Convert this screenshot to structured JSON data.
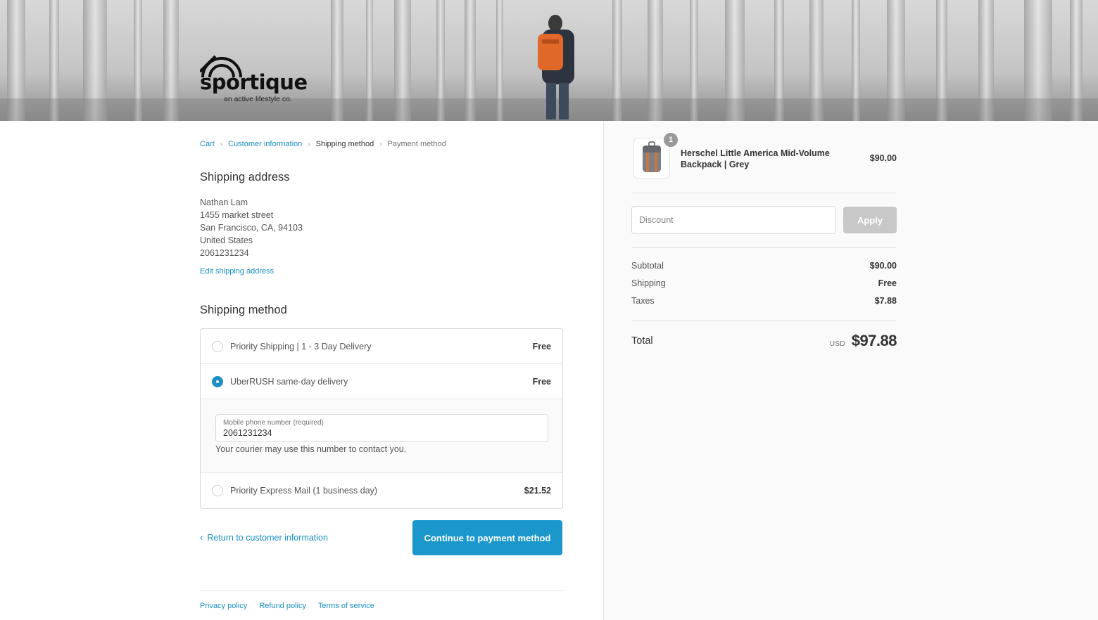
{
  "brand": {
    "name": "sportique",
    "tagline": "an active lifestyle co."
  },
  "breadcrumb": {
    "items": [
      {
        "label": "Cart"
      },
      {
        "label": "Customer information"
      },
      {
        "label": "Shipping method"
      },
      {
        "label": "Payment method"
      }
    ]
  },
  "shipping_address": {
    "title": "Shipping address",
    "lines": [
      "Nathan Lam",
      "1455 market street",
      "San Francisco, CA, 94103",
      "United States",
      "2061231234"
    ],
    "edit_label": "Edit shipping address"
  },
  "shipping_method": {
    "title": "Shipping method",
    "options": [
      {
        "label": "Priority Shipping | 1 - 3 Day Delivery",
        "price": "Free",
        "selected": false
      },
      {
        "label": "UberRUSH same-day delivery",
        "price": "Free",
        "selected": true
      },
      {
        "label": "Priority Express Mail (1 business day)",
        "price": "$21.52",
        "selected": false
      }
    ],
    "phone": {
      "label": "Mobile phone number (required)",
      "value": "2061231234",
      "help": "Your courier may use this number to contact you."
    }
  },
  "actions": {
    "return_label": "Return to customer information",
    "continue_label": "Continue to payment method"
  },
  "footer": {
    "links": [
      "Privacy policy",
      "Refund policy",
      "Terms of service"
    ]
  },
  "order": {
    "product": {
      "name": "Herschel Little America Mid-Volume Backpack | Grey",
      "price": "$90.00",
      "quantity": "1"
    },
    "discount": {
      "placeholder": "Discount",
      "apply_label": "Apply"
    },
    "summary": {
      "subtotal_label": "Subtotal",
      "subtotal": "$90.00",
      "shipping_label": "Shipping",
      "shipping": "Free",
      "taxes_label": "Taxes",
      "taxes": "$7.88",
      "total_label": "Total",
      "currency": "USD",
      "total": "$97.88"
    }
  },
  "colors": {
    "accent": "#1b97cc",
    "link": "#1990c6",
    "sidebar_bg": "#fafafa",
    "apply_disabled": "#c8c8c8"
  }
}
